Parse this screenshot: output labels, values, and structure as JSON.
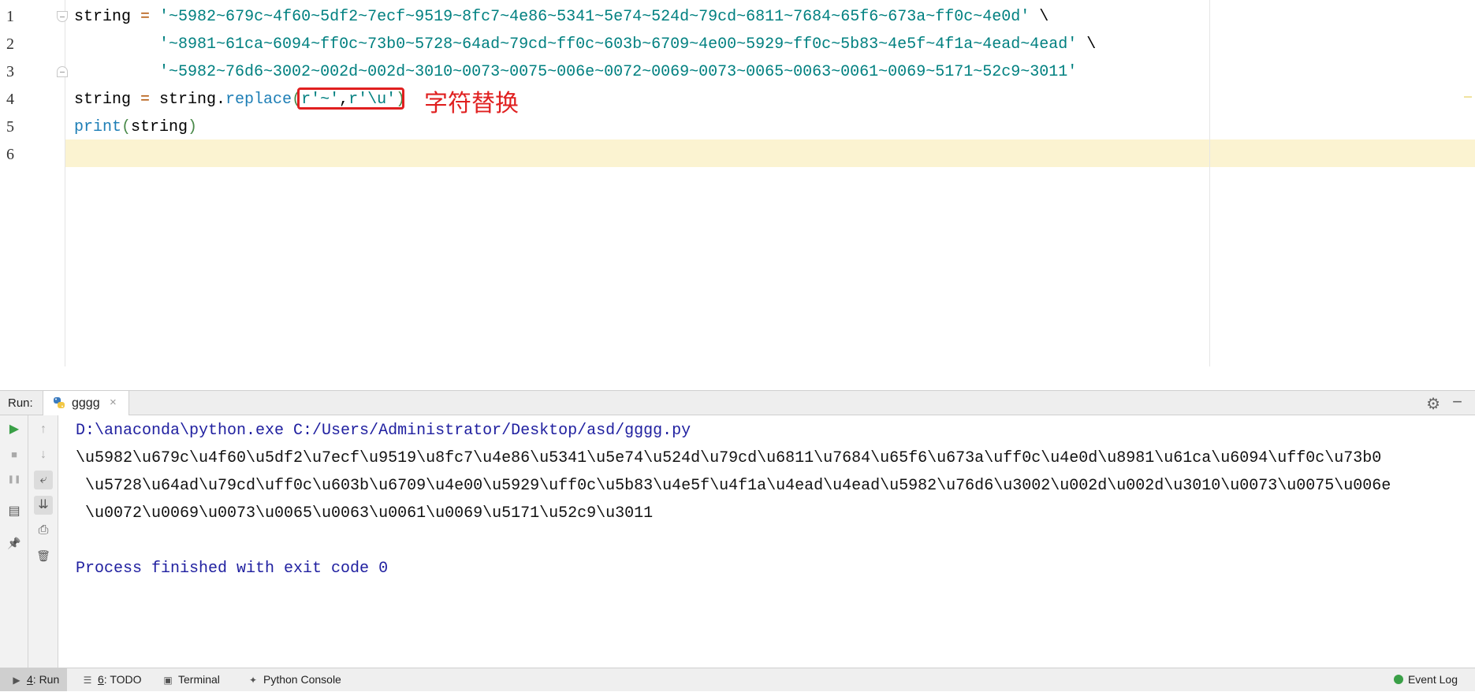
{
  "editor": {
    "line_numbers": [
      "1",
      "2",
      "3",
      "4",
      "5",
      "6"
    ],
    "lines": [
      {
        "parts": [
          [
            "plain",
            "string "
          ],
          [
            "op",
            "="
          ],
          [
            "plain",
            " "
          ],
          [
            "str",
            "'~5982~679c~4f60~5df2~7ecf~9519~8fc7~4e86~5341~5e74~524d~79cd~6811~7684~65f6~673a~ff0c~4e0d'"
          ],
          [
            "plain",
            " \\"
          ]
        ]
      },
      {
        "parts": [
          [
            "plain",
            "         "
          ],
          [
            "str",
            "'~8981~61ca~6094~ff0c~73b0~5728~64ad~79cd~ff0c~603b~6709~4e00~5929~ff0c~5b83~4e5f~4f1a~4ead~4ead'"
          ],
          [
            "plain",
            " \\"
          ]
        ]
      },
      {
        "parts": [
          [
            "plain",
            "         "
          ],
          [
            "str",
            "'~5982~76d6~3002~002d~002d~3010~0073~0075~006e~0072~0069~0073~0065~0063~0061~0069~5171~52c9~3011'"
          ]
        ]
      },
      {
        "parts": [
          [
            "plain",
            "string "
          ],
          [
            "op",
            "="
          ],
          [
            "plain",
            " string."
          ],
          [
            "fn",
            "replace"
          ],
          [
            "paren",
            "("
          ],
          [
            "str",
            "r'~'"
          ],
          [
            "plain",
            ","
          ],
          [
            "str",
            "r'\\u'"
          ],
          [
            "paren",
            ")"
          ]
        ]
      },
      {
        "parts": [
          [
            "fn",
            "print"
          ],
          [
            "paren",
            "("
          ],
          [
            "plain",
            "string"
          ],
          [
            "paren",
            ")"
          ]
        ]
      },
      {
        "parts": []
      }
    ],
    "annotation": "字符替换"
  },
  "run_panel": {
    "label": "Run:",
    "tab_name": "gggg",
    "close_glyph": "×",
    "gear_glyph": "⚙",
    "hide_glyph": "−",
    "console_lines": [
      {
        "cls": "cl-blue",
        "text": "D:\\anaconda\\python.exe C:/Users/Administrator/Desktop/asd/gggg.py"
      },
      {
        "cls": "cl-black",
        "text": "\\u5982\\u679c\\u4f60\\u5df2\\u7ecf\\u9519\\u8fc7\\u4e86\\u5341\\u5e74\\u524d\\u79cd\\u6811\\u7684\\u65f6\\u673a\\uff0c\\u4e0d\\u8981\\u61ca\\u6094\\uff0c\\u73b0"
      },
      {
        "cls": "cl-black",
        "text": " \\u5728\\u64ad\\u79cd\\uff0c\\u603b\\u6709\\u4e00\\u5929\\uff0c\\u5b83\\u4e5f\\u4f1a\\u4ead\\u4ead\\u5982\\u76d6\\u3002\\u002d\\u002d\\u3010\\u0073\\u0075\\u006e"
      },
      {
        "cls": "cl-black",
        "text": " \\u0072\\u0069\\u0073\\u0065\\u0063\\u0061\\u0069\\u5171\\u52c9\\u3011"
      },
      {
        "cls": "cl-black",
        "text": ""
      },
      {
        "cls": "cl-blue",
        "text": "Process finished with exit code 0"
      }
    ]
  },
  "toolbar": {
    "rerun_glyph": "▶",
    "stop_glyph": "■",
    "pause_glyph": "❚❚",
    "layout_glyph": "▤",
    "pin_glyph": "📌",
    "up_glyph": "↑",
    "down_glyph": "↓",
    "wrap_glyph": "⤶",
    "scroll_end_glyph": "⇊",
    "print_glyph": "⎙",
    "trash_glyph": "🗑"
  },
  "statusbar": {
    "run_mnemonic": "4",
    "run_label": ": Run",
    "todo_mnemonic": "6",
    "todo_label": ": TODO",
    "terminal_label": "Terminal",
    "python_console_label": "Python Console",
    "event_log_label": "Event Log"
  },
  "colors": {
    "accent_red": "#e02020",
    "caret_row": "#fbf3d1",
    "run_green": "#3aa047"
  }
}
